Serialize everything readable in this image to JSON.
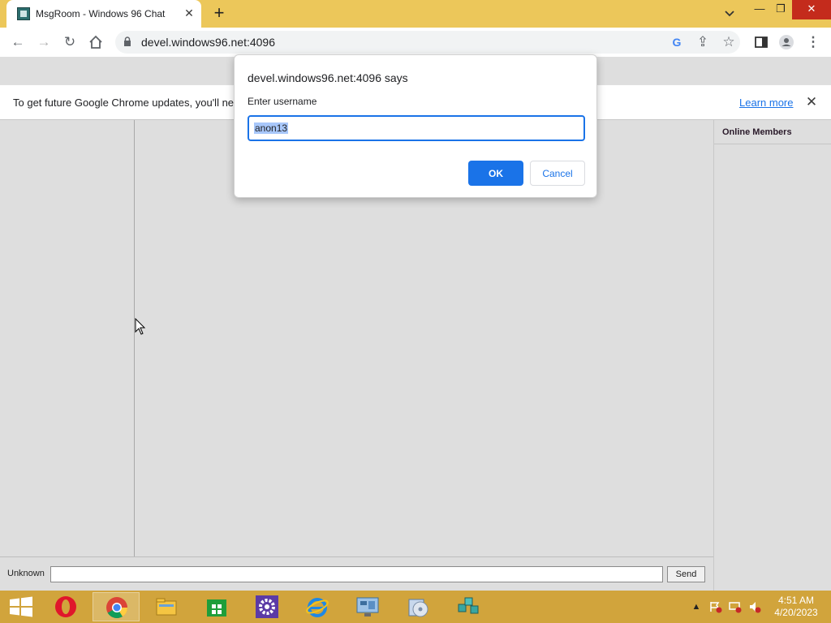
{
  "browser": {
    "tab_title": "MsgRoom - Windows 96 Chat",
    "tab_close": "✕",
    "new_tab": "+",
    "url": "devel.windows96.net:4096",
    "min": "—",
    "restore": "❐",
    "close": "✕"
  },
  "infobar": {
    "text": "To get future Google Chrome updates, you'll ne",
    "learn_more": "Learn more",
    "close": "✕"
  },
  "chat": {
    "online_members": "Online Members",
    "username_label": "Unknown",
    "message_value": "",
    "send_label": "Send"
  },
  "dialog": {
    "title": "devel.windows96.net:4096 says",
    "label": "Enter username",
    "input_value": "anon13",
    "ok_label": "OK",
    "cancel_label": "Cancel"
  },
  "taskbar": {
    "apps": [
      "opera-icon",
      "chrome-icon",
      "file-explorer-icon",
      "store-icon",
      "settings-icon",
      "internet-explorer-icon",
      "control-panel-icon",
      "media-player-icon",
      "network-icon"
    ],
    "time": "4:51 AM",
    "date": "4/20/2023"
  },
  "colors": {
    "title_bar": "#ecc75a",
    "accent": "#1a73e8",
    "taskbar": "#d1a43c",
    "page_bg": "#dedede"
  }
}
